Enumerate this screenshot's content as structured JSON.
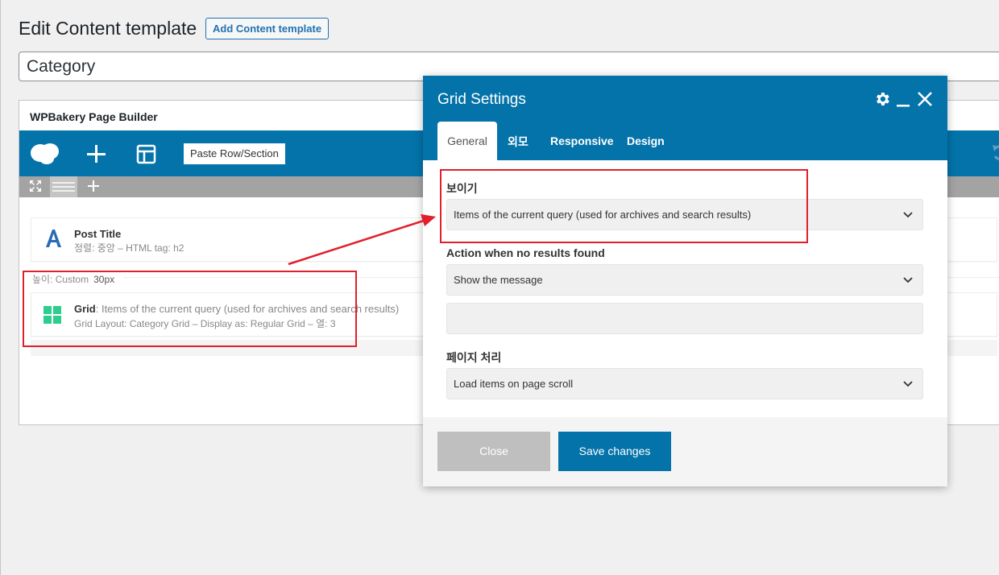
{
  "page": {
    "title": "Edit Content template",
    "add_button": "Add Content template",
    "title_value": "Category"
  },
  "builder": {
    "heading": "WPBakery Page Builder",
    "toolbar": {
      "paste_label": "Paste Row/Section"
    },
    "post_title": {
      "title": "Post Title",
      "sub": "정렬: 중앙  – HTML tag: h2"
    },
    "spacer": {
      "label": "높이: Custom",
      "value": "30px"
    },
    "grid": {
      "title": "Grid",
      "title_rest": ": Items of the current query (used for archives and search results)",
      "sub": "Grid Layout: Category Grid  – Display as: Regular Grid  – 열: 3"
    }
  },
  "modal": {
    "title": "Grid Settings",
    "tabs": [
      "General",
      "외모",
      "Responsive",
      "Design"
    ],
    "fields": {
      "display": {
        "label": "보이기",
        "value": "Items of the current query (used for archives and search results)"
      },
      "no_results": {
        "label": "Action when no results found",
        "value": "Show the message",
        "message_value": ""
      },
      "pagination": {
        "label": "페이지 처리",
        "value": "Load items on page scroll"
      }
    },
    "buttons": {
      "close": "Close",
      "save": "Save changes"
    }
  },
  "colors": {
    "accent": "#0473aa",
    "highlight": "#e0202a",
    "grid_icon": "#2ecc8f"
  }
}
